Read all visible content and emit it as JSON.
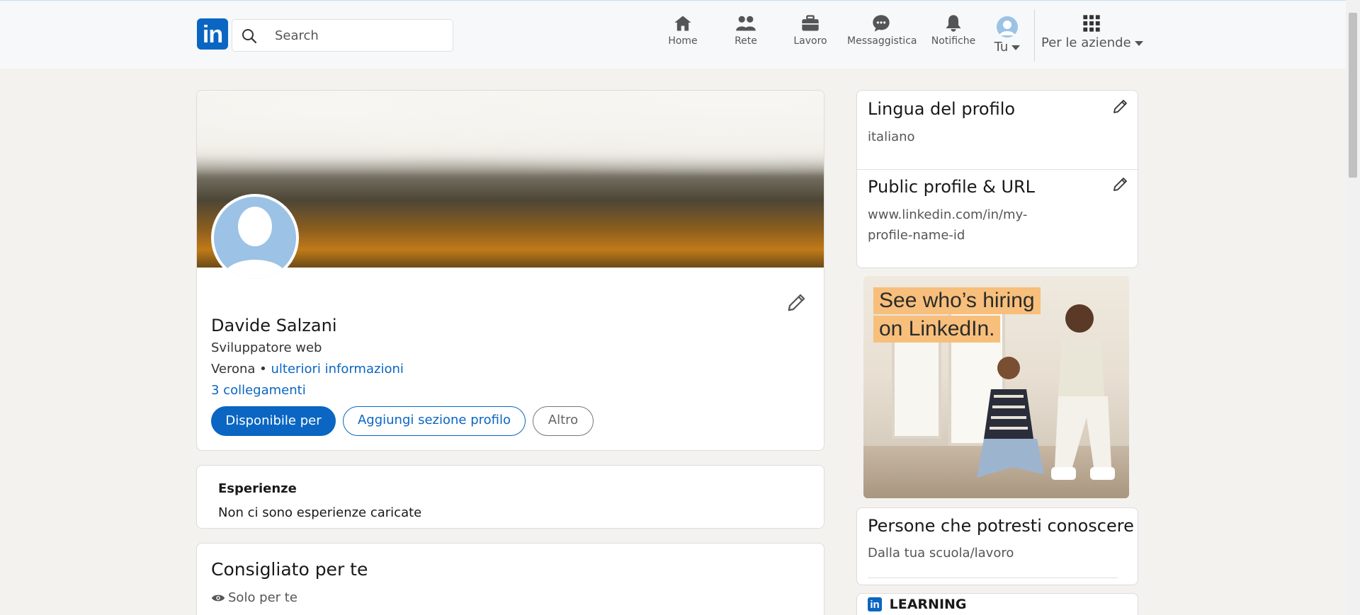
{
  "nav": {
    "logo_text": "in",
    "search_placeholder": "Search",
    "items": [
      {
        "label": "Home",
        "icon": "home-icon"
      },
      {
        "label": "Rete",
        "icon": "people-icon"
      },
      {
        "label": "Lavoro",
        "icon": "briefcase-icon"
      },
      {
        "label": "Messaggistica",
        "icon": "chat-icon"
      },
      {
        "label": "Notifiche",
        "icon": "bell-icon"
      }
    ],
    "me_label": "Tu",
    "business_label": "Per le aziende"
  },
  "profile": {
    "name": "Davide Salzani",
    "headline": "Sviluppatore web",
    "location": "Verona",
    "separator": " • ",
    "more_info": "ulteriori informazioni",
    "connections": "3 collegamenti",
    "buttons": {
      "available": "Disponibile per",
      "add_section": "Aggiungi sezione profilo",
      "more": "Altro"
    }
  },
  "experience": {
    "title": "Esperienze",
    "empty_text": "Non ci sono esperienze caricate"
  },
  "recommended": {
    "title": "Consigliato per te",
    "visibility": "Solo per te"
  },
  "sidebar": {
    "language": {
      "title": "Lingua del profilo",
      "value": "italiano"
    },
    "public_profile": {
      "title": "Public profile & URL",
      "url_line1": "www.linkedin.com/in/my-",
      "url_line2": "profile-name-id"
    },
    "ad": {
      "line1": "See who’s hiring",
      "line2": "on LinkedIn."
    },
    "people": {
      "title": "Persone che potresti conoscere",
      "subtitle": "Dalla tua scuola/lavoro"
    },
    "learning": {
      "logo_text": "in",
      "title": "LEARNING"
    }
  },
  "colors": {
    "brand": "#0a66c2",
    "background": "#f3f2ef"
  }
}
